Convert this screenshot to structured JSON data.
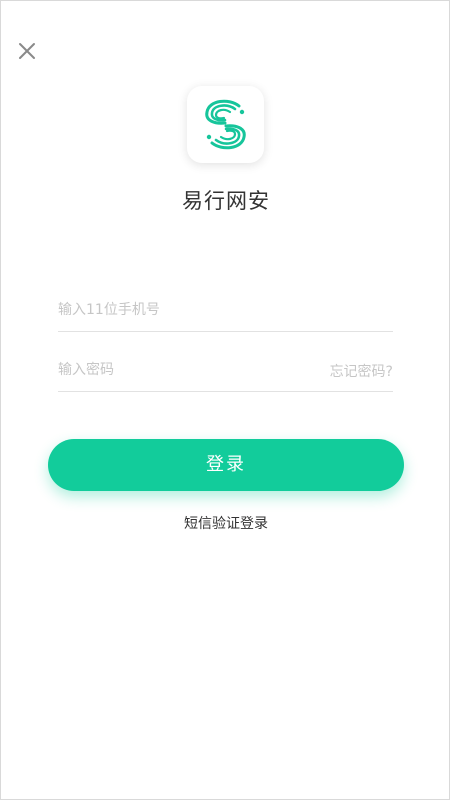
{
  "header": {
    "close_icon": "close-icon"
  },
  "app": {
    "logo_icon": "swirl-s-logo",
    "name": "易行网安"
  },
  "form": {
    "phone_placeholder": "输入11位手机号",
    "password_placeholder": "输入密码",
    "forgot_password": "忘记密码?",
    "login_button": "登录",
    "sms_login": "短信验证登录"
  },
  "colors": {
    "primary": "#12cc9b",
    "placeholder": "#c6c6c6",
    "text": "#333333"
  }
}
